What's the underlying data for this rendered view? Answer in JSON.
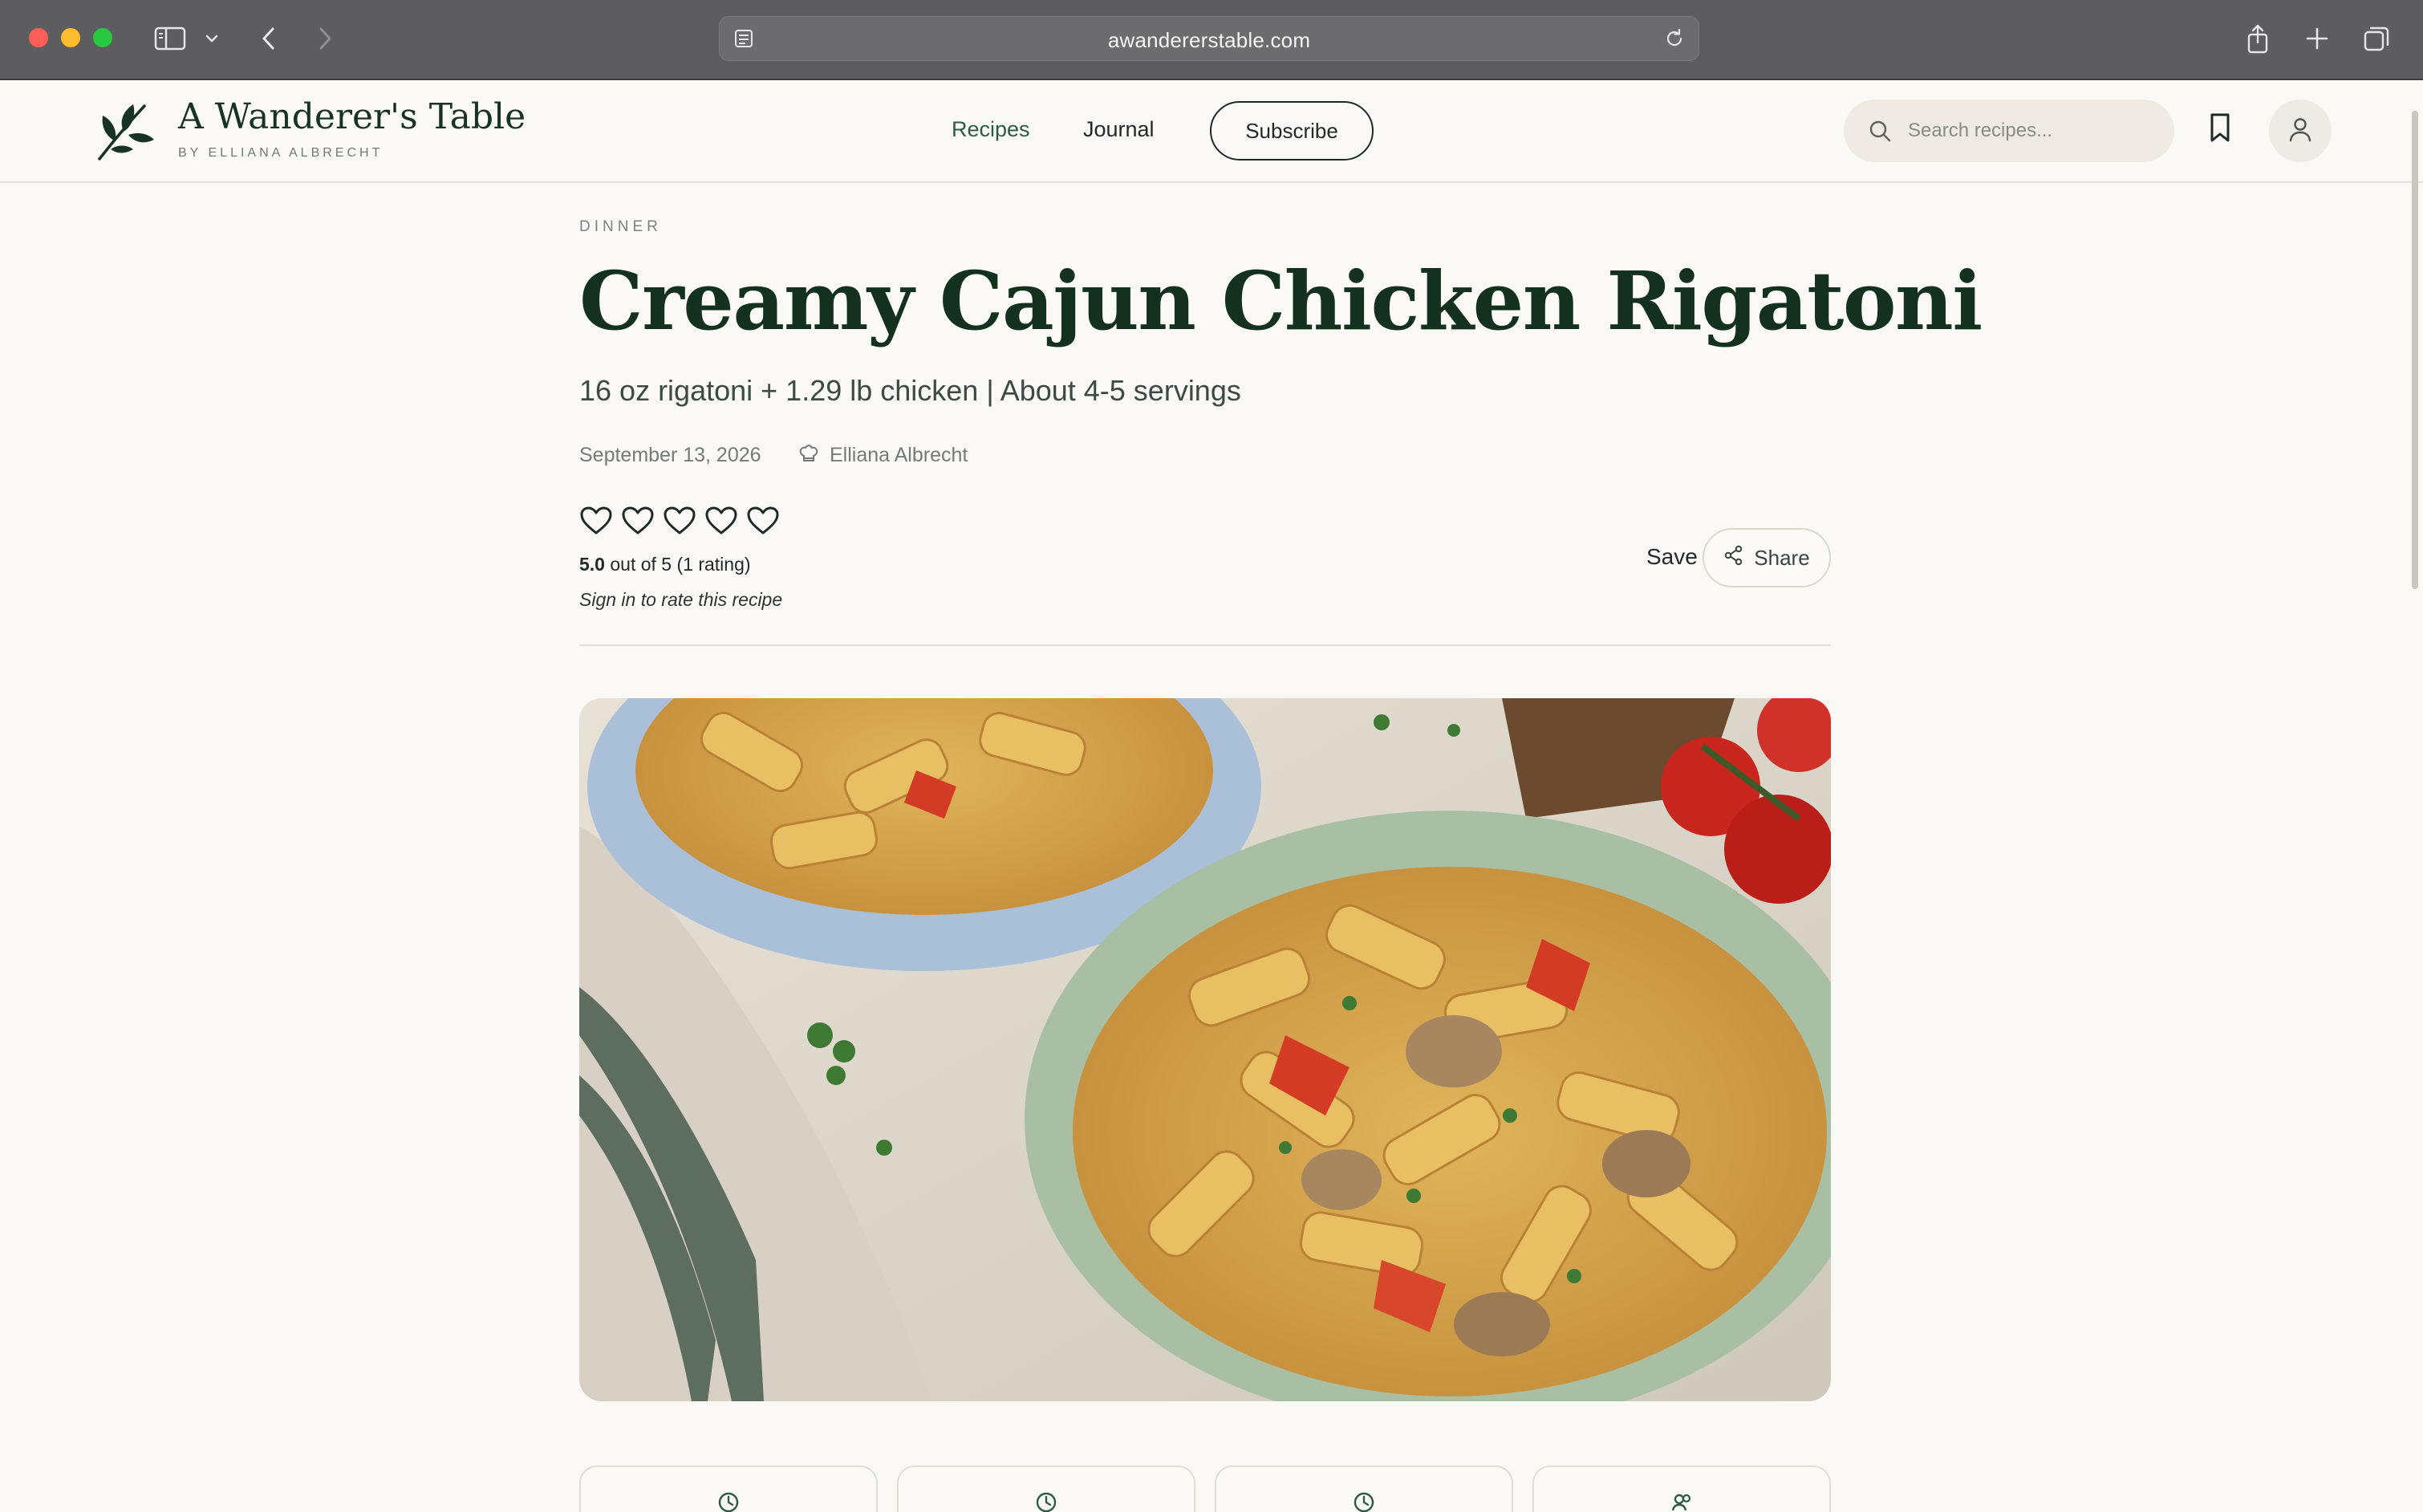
{
  "browser": {
    "url": "awandererstable.com"
  },
  "site": {
    "brand_title": "A Wanderer's Table",
    "brand_subtitle": "BY ELLIANA ALBRECHT",
    "nav": {
      "recipes": "Recipes",
      "journal": "Journal",
      "subscribe": "Subscribe"
    },
    "search_placeholder": "Search recipes..."
  },
  "recipe": {
    "category": "DINNER",
    "title": "Creamy Cajun Chicken Rigatoni",
    "subtitle": "16 oz rigatoni + 1.29 lb chicken | About 4-5 servings",
    "date": "September 13, 2026",
    "author": "Elliana Albrecht",
    "rating": {
      "score": "5.0",
      "suffix": "out of 5 (1 rating)",
      "signin_note": "Sign in to rate this recipe",
      "hearts_total": 5
    },
    "actions": {
      "save": "Save",
      "share": "Share"
    }
  },
  "colors": {
    "brand_green": "#14301f",
    "nav_green": "#2f5a45",
    "page_bg": "#faf9f6",
    "chrome_bg": "#5d5d5f"
  },
  "icons": [
    "sidebar-toggle-icon",
    "chevron-down-icon",
    "back-arrow-icon",
    "forward-arrow-icon",
    "reader-icon",
    "reload-icon",
    "share-icon",
    "new-tab-icon",
    "tabs-overview-icon",
    "leaf-logo-icon",
    "search-icon",
    "bookmark-icon",
    "user-icon",
    "chef-hat-icon",
    "heart-icon",
    "clock-icon",
    "servings-icon"
  ]
}
